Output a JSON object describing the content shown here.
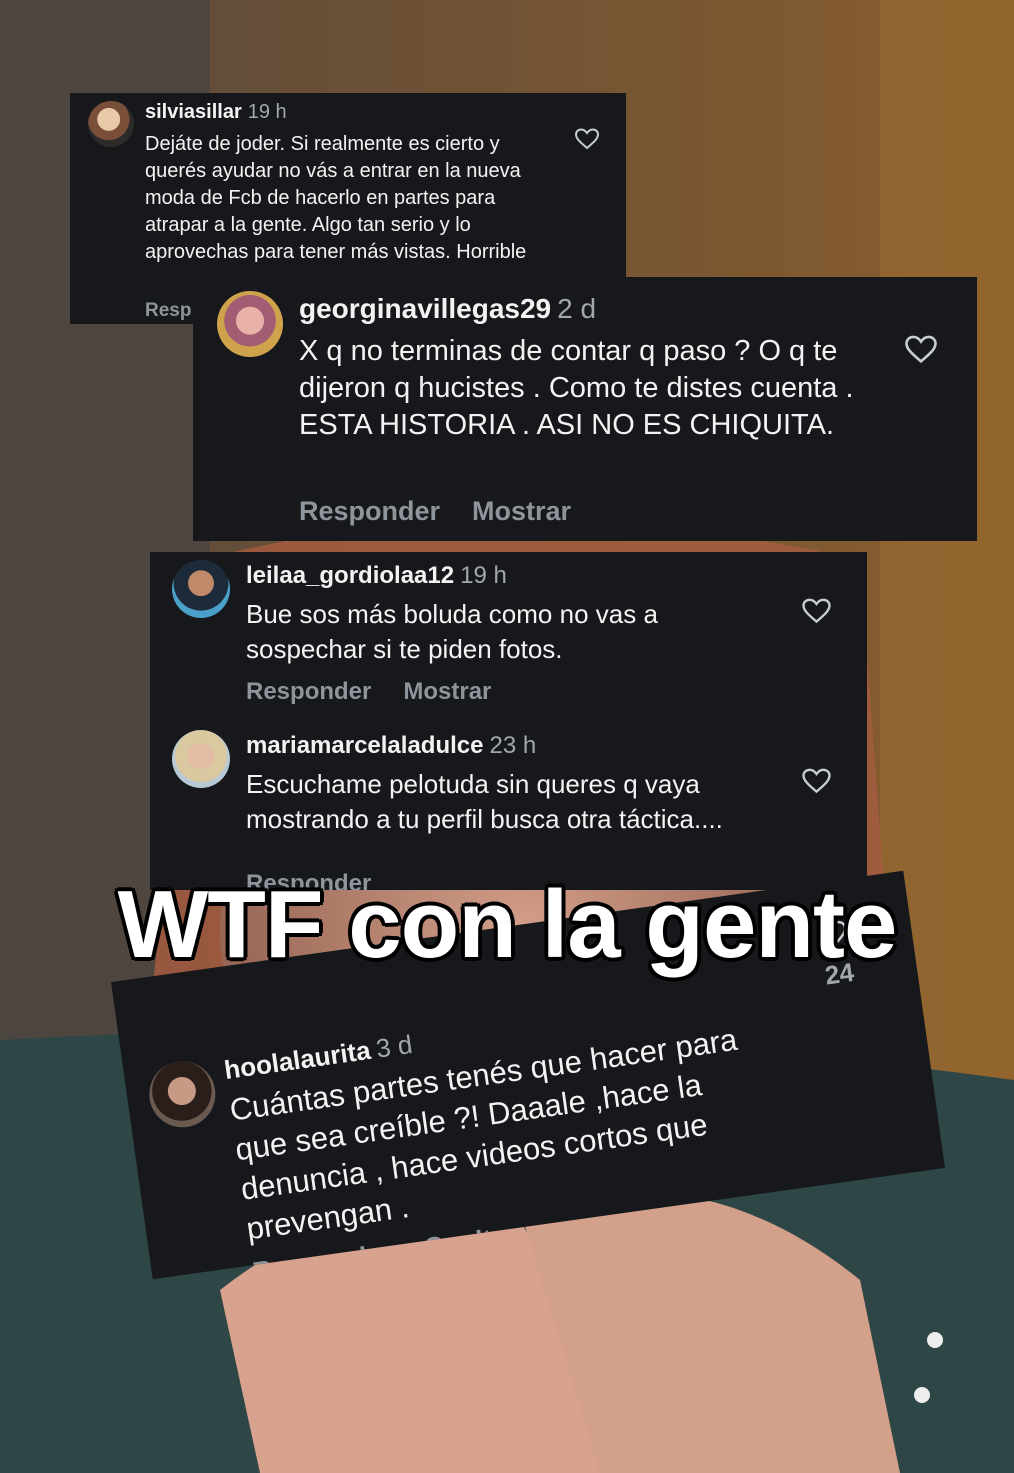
{
  "overlay_title": "WTF con la gente",
  "comments": [
    {
      "username": "silviasillar",
      "time": "19 h",
      "text": "Dejáte de joder. Si realmente  es cierto y querés ayudar no vás a entrar en la nueva moda de Fcb de hacerlo en partes para atrapar a la gente. Algo tan serio y lo aprovechas para tener más vistas. Horrible",
      "reply": "Resp"
    },
    {
      "username": "georginavillegas29",
      "time": "2 d",
      "text": "X q no terminas de contar  q paso ? O q te dijeron q hucistes . Como te distes cuenta . ESTA HISTORIA . ASI NO ES CHIQUITA.",
      "reply": "Responder",
      "show": "Mostrar"
    },
    {
      "username": "leilaa_gordiolaa12",
      "time": "19 h",
      "text": "Bue sos más boluda como no vas a sospechar si te piden fotos.",
      "reply": "Responder",
      "show": "Mostrar"
    },
    {
      "username": "mariamarcelaladulce",
      "time": "23 h",
      "text": "Escuchame pelotuda  sin queres q vaya mostrando a tu perfil busca otra táctica....",
      "reply": "Responder"
    },
    {
      "username": "hoolalaurita",
      "time": "3 d",
      "text": "Cuántas partes tenés que hacer para que sea creíble ?! Daaale ,hace la denuncia , hace videos cortos que prevengan .",
      "reply": "Responder",
      "hide": "Ocultar",
      "likes": "24"
    }
  ],
  "icons": {
    "like": "heart-outline-icon"
  },
  "colors": {
    "card_bg": "#16181b",
    "muted": "#8e949b"
  }
}
